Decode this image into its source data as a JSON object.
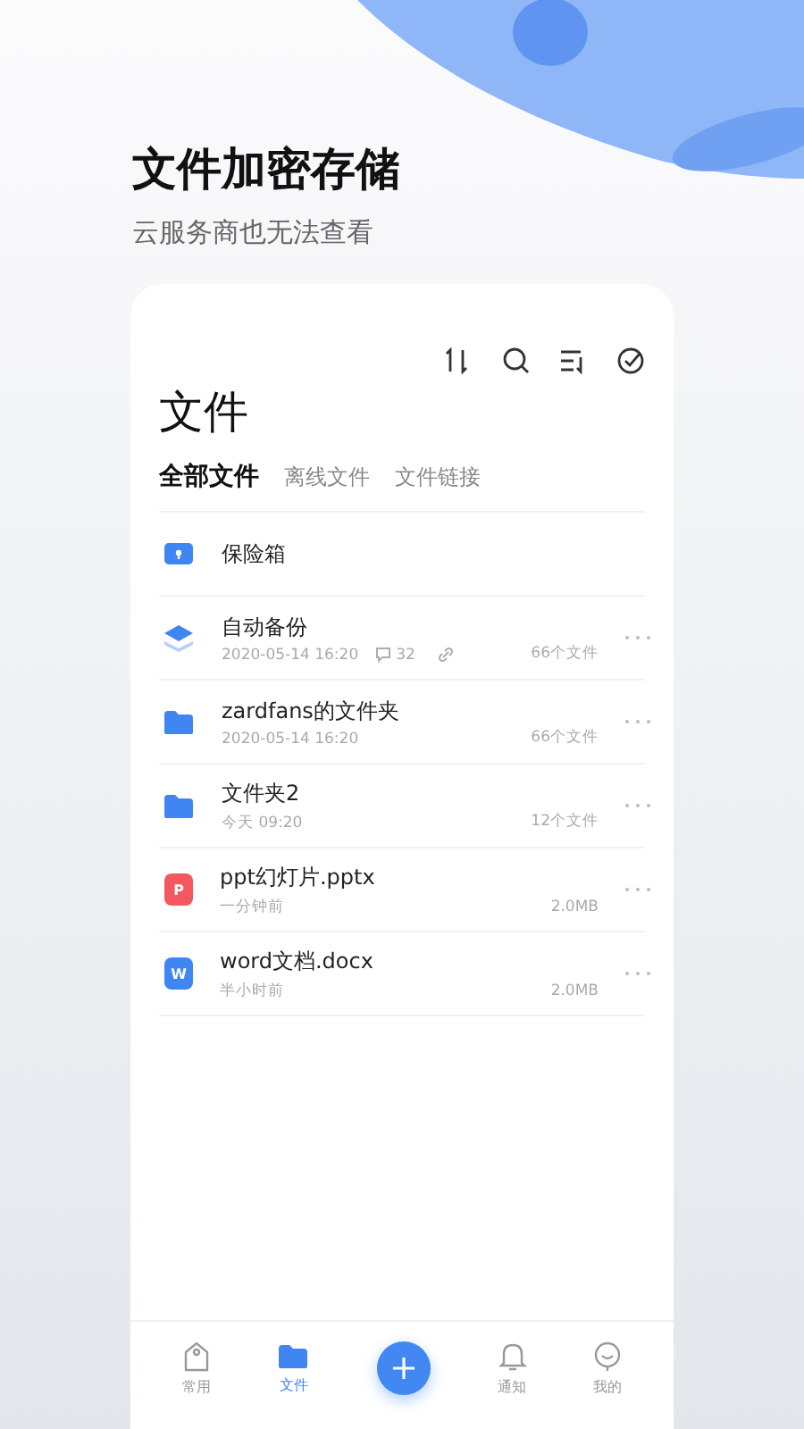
{
  "header": {
    "title": "文件加密存储",
    "subtitle": "云服务商也无法查看"
  },
  "page_title": "文件",
  "tabs": [
    {
      "label": "全部文件",
      "selected": true
    },
    {
      "label": "离线文件",
      "selected": false
    },
    {
      "label": "文件链接",
      "selected": false
    }
  ],
  "files": [
    {
      "kind": "vault",
      "name": "保险箱"
    },
    {
      "kind": "backup",
      "name": "自动备份",
      "date": "2020-05-14 16:20",
      "comments": "32",
      "linked": true,
      "info": "66个文件"
    },
    {
      "kind": "folder",
      "name": "zardfans的文件夹",
      "date": "2020-05-14 16:20",
      "info": "66个文件"
    },
    {
      "kind": "folder",
      "name": "文件夹2",
      "date": "今天 09:20",
      "info": "12个文件"
    },
    {
      "kind": "ppt",
      "name": "ppt幻灯片.pptx",
      "icon_letter": "P",
      "date": "一分钟前",
      "info": "2.0MB"
    },
    {
      "kind": "word",
      "name": "word文档.docx",
      "icon_letter": "W",
      "date": "半小时前",
      "info": "2.0MB"
    }
  ],
  "bottom_nav": [
    {
      "kind": "tag",
      "label": "常用",
      "selected": false
    },
    {
      "kind": "folder",
      "label": "文件",
      "selected": true
    },
    {
      "kind": "add"
    },
    {
      "kind": "bell",
      "label": "通知",
      "selected": false
    },
    {
      "kind": "face",
      "label": "我的",
      "selected": false
    }
  ]
}
